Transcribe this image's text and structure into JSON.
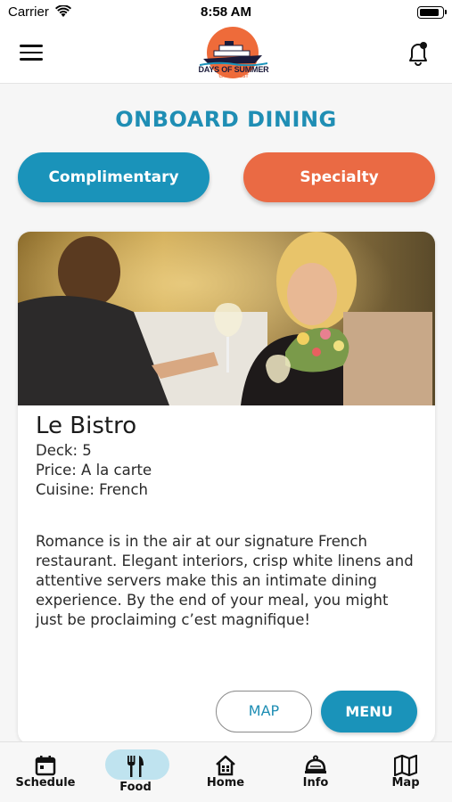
{
  "status_bar": {
    "carrier": "Carrier",
    "time": "8:58 AM",
    "battery_level": 0.9
  },
  "header": {
    "logo_text": "DAYS OF SUMMER",
    "logo_subtext": "CRUISE FEST",
    "menu_icon": "hamburger-icon",
    "notification_icon": "bell-icon"
  },
  "page": {
    "title": "ONBOARD DINING",
    "tabs": [
      {
        "label": "Complimentary",
        "color": "#1a93ba"
      },
      {
        "label": "Specialty",
        "color": "#ea6a44"
      }
    ]
  },
  "restaurant": {
    "name": "Le Bistro",
    "deck": "Deck: 5",
    "price": "Price: A la carte",
    "cuisine": "Cuisine: French",
    "description": "Romance is in the air at our signature French restaurant. Elegant interiors, crisp white linens and attentive servers make this an intimate dining experience. By the end of your meal, you might just be proclaiming c’est magnifique!",
    "map_label": "MAP",
    "menu_label": "MENU"
  },
  "tab_bar": {
    "items": [
      {
        "label": "Schedule",
        "icon": "calendar-icon"
      },
      {
        "label": "Food",
        "icon": "fork-knife-icon",
        "active": true
      },
      {
        "label": "Home",
        "icon": "home-icon"
      },
      {
        "label": "Info",
        "icon": "cloche-icon"
      },
      {
        "label": "Map",
        "icon": "map-icon"
      }
    ]
  },
  "colors": {
    "primary": "#1a93ba",
    "accent": "#ea6a44",
    "title": "#1f8eb4",
    "active_tab_bg": "#bfe3ef"
  }
}
